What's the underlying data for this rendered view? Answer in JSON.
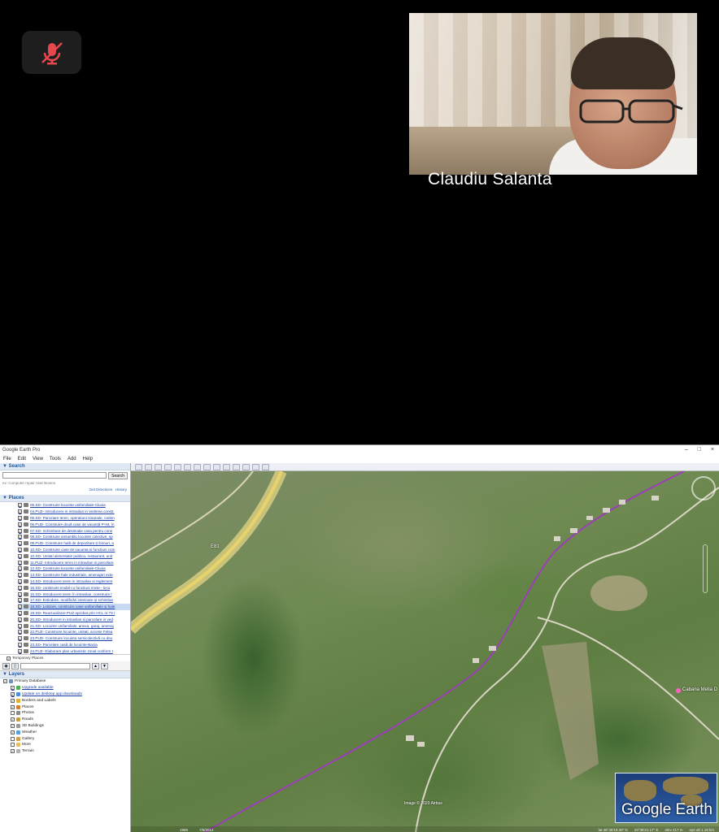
{
  "meeting": {
    "participant_name": "Claudiu Salanta",
    "mic_state": "muted"
  },
  "google_earth": {
    "window_title": "Google Earth Pro",
    "window_controls": [
      "–",
      "□",
      "×"
    ],
    "menu": [
      "File",
      "Edit",
      "View",
      "Tools",
      "Add",
      "Help"
    ],
    "search": {
      "header": "Search",
      "button": "Search",
      "hint": "ex: Computer repair near Boston",
      "get_directions": "Get Directions",
      "history": "History"
    },
    "places": {
      "header": "Places",
      "items": [
        {
          "label": "05.SD- Construire locuinte unifamiliale-Cluoia",
          "selected": false
        },
        {
          "label": "04.PUZ- Introducere in intravilan in vederea constr.",
          "selected": false
        },
        {
          "label": "05.SD- Parcelare teren, operatiuni notariale, ceden",
          "selected": false
        },
        {
          "label": "06.PUD- Construire două case de vacanță P+M, în",
          "selected": false
        },
        {
          "label": "07.SD- Schimbare de destinatie casa pentru cons",
          "selected": false
        },
        {
          "label": "08.SD- Construire ansamblu locuinte colective, sp",
          "selected": false
        },
        {
          "label": "09.PUD- Construire hală de depozitare și birouri, a",
          "selected": false
        },
        {
          "label": "10.SD- Construire case de vacanta si functiuni com",
          "selected": false
        },
        {
          "label": "10.SD- Unitati alimentatie publica, restaurant, unit",
          "selected": false
        },
        {
          "label": "11.PUZ- Introducere teren in intravilan si parcelare",
          "selected": false
        },
        {
          "label": "12.SD- Construire locuinte unifamiliale-Cluoia",
          "selected": false
        },
        {
          "label": "13.SD- Construire hale industriale, amenajari exte",
          "selected": false
        },
        {
          "label": "14.SD- Introducere teren in intravilan si reglement",
          "selected": false
        },
        {
          "label": "16.SD- construire imobil cu functiuni mixte - locu",
          "selected": false
        },
        {
          "label": "15.SD- Introducere teren în intravilan, construire l",
          "selected": false
        },
        {
          "label": "17.SD- Extindere, modificări interioare și schimbar",
          "selected": false
        },
        {
          "label": "18.SD- Lotizare, construire case unifamiliale și hale",
          "selected": true
        },
        {
          "label": "19.SD- Reactualizare PUZ aprobat prin HCL nr.73 /",
          "selected": false
        },
        {
          "label": "20.SD- Introducere in intravilan si parcelare in ved",
          "selected": false
        },
        {
          "label": "21.SD- Locuinte unifamiliale, anexa, garaj, amenaj",
          "selected": false
        },
        {
          "label": "22.PUZ- Construire locuinte, unitati, accese Felea",
          "selected": false
        },
        {
          "label": "23.PUD- Construire locuinta semicolectivă cu dou",
          "selected": false
        },
        {
          "label": "23.SD- Parcelare casă de locuinte-Bacia",
          "selected": false
        },
        {
          "label": "24.PUZ- Elaborare plan urbanistic zonal conform t",
          "selected": false
        }
      ],
      "temporary": "Temporary Places"
    },
    "layers": {
      "header": "Layers",
      "items": [
        {
          "label": "Primary Database",
          "link": false,
          "color": "#6b8fbf"
        },
        {
          "label": "Upgrade available",
          "link": true,
          "color": "#4caf50"
        },
        {
          "label": "Update on desktop app downloads",
          "link": true,
          "color": "#4a8fe0"
        },
        {
          "label": "Borders and Labels",
          "link": false,
          "color": "#e0b030"
        },
        {
          "label": "Places",
          "link": false,
          "color": "#d08030"
        },
        {
          "label": "Photos",
          "link": false,
          "color": "#8a8a8a"
        },
        {
          "label": "Roads",
          "link": false,
          "color": "#c0a040"
        },
        {
          "label": "3D Buildings",
          "link": false,
          "color": "#9a9a9a"
        },
        {
          "label": "Weather",
          "link": false,
          "color": "#5aa0d8"
        },
        {
          "label": "Gallery",
          "link": false,
          "color": "#d0a050"
        },
        {
          "label": "More",
          "link": false,
          "color": "#e0c060"
        },
        {
          "label": "Terrain",
          "link": false,
          "color": "#b0b0b0"
        }
      ]
    },
    "map": {
      "road_label": "E81",
      "place_label": "Cabana Melia D",
      "imagery_credit": "Image © 2020 Airbus",
      "status_date": "7/6/2014",
      "year": "1986",
      "status_right": [
        "lat 46°45'19.30\" N",
        "23°35'21.17\" E",
        "elev 417 m",
        "eye alt 1.19 km"
      ],
      "logo": "Google Earth"
    }
  }
}
